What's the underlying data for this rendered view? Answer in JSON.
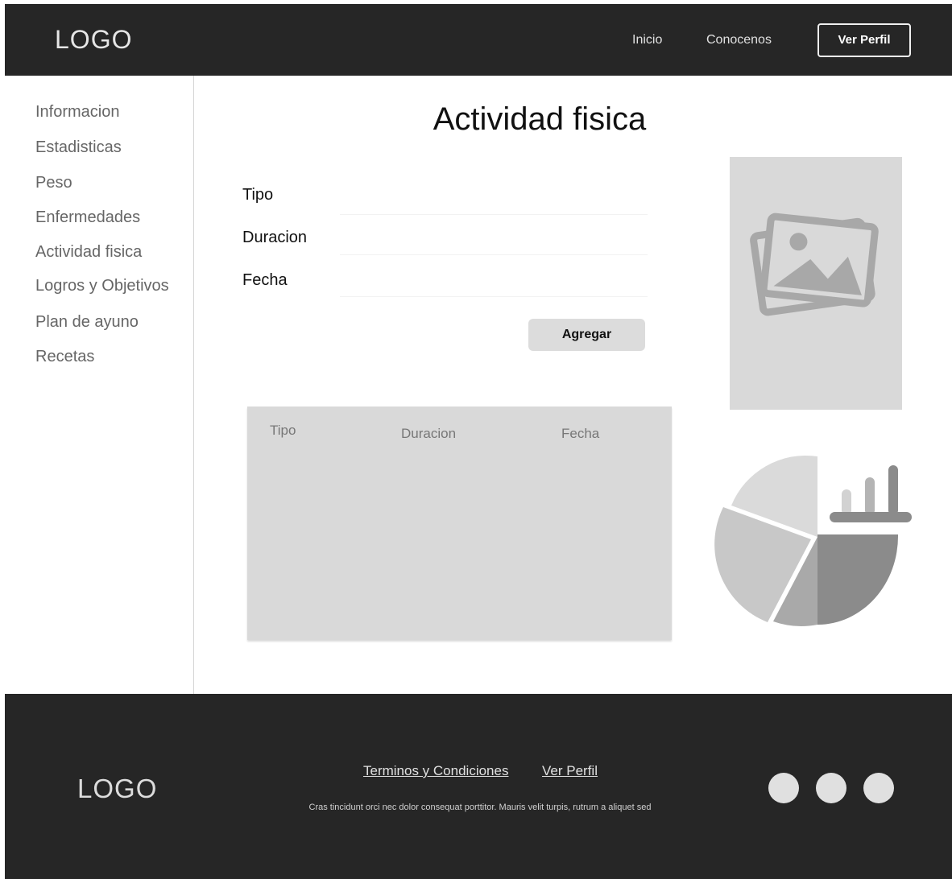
{
  "header": {
    "logo": "LOGO",
    "nav": [
      {
        "label": "Inicio"
      },
      {
        "label": "Conocenos"
      }
    ],
    "profile_button": "Ver Perfil"
  },
  "sidebar": {
    "items": [
      {
        "label": "Informacion"
      },
      {
        "label": "Estadisticas"
      },
      {
        "label": "Peso"
      },
      {
        "label": "Enfermedades"
      },
      {
        "label": "Actividad fisica"
      },
      {
        "label": "Logros y Objetivos"
      },
      {
        "label": "Plan de ayuno"
      },
      {
        "label": "Recetas"
      }
    ]
  },
  "main": {
    "title": "Actividad fisica",
    "form": {
      "fields": [
        {
          "label": "Tipo",
          "value": "",
          "placeholder": ""
        },
        {
          "label": "Duracion",
          "value": "",
          "placeholder": ""
        },
        {
          "label": "Fecha",
          "value": "",
          "placeholder": ""
        }
      ],
      "submit_label": "Agregar"
    },
    "table": {
      "columns": [
        "Tipo",
        "Duracion",
        "Fecha"
      ],
      "rows": []
    },
    "image_placeholder_icon": "image-icon",
    "illustration_icon": "pie-chart-icon"
  },
  "footer": {
    "logo": "LOGO",
    "links": [
      {
        "label": "Terminos y Condiciones"
      },
      {
        "label": "Ver Perfil"
      }
    ],
    "text": "Cras tincidunt orci nec dolor consequat porttitor. Mauris velit turpis, rutrum a aliquet sed",
    "social_icons": [
      "social-icon",
      "social-icon",
      "social-icon"
    ]
  },
  "colors": {
    "dark_bar": "#262626",
    "placeholder_gray": "#d9d9d9",
    "button_gray": "#dcdcdc"
  }
}
